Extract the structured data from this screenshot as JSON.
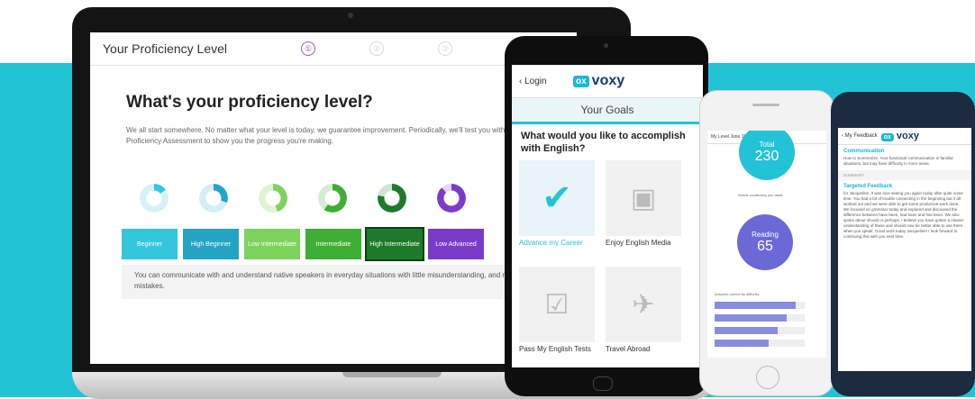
{
  "colors": {
    "background_band": "#23c3d6",
    "accent": "#1bb6d6",
    "purple": "#6b69d6"
  },
  "laptop": {
    "header_title": "Your Proficiency Level",
    "steps": [
      "①",
      "②",
      "③"
    ],
    "heading": "What's your proficiency level?",
    "intro": "We all start somewhere. No matter what your level is today, we guarantee improvement. Periodically, we'll test you with the Voxy Proficiency Assessment to show you the progress you're making.",
    "levels": [
      {
        "label": "Beginner",
        "color": "#33c6dc"
      },
      {
        "label": "High Beginner",
        "color": "#25a4c4"
      },
      {
        "label": "Low Intermediate",
        "color": "#7ed35c"
      },
      {
        "label": "Intermediate",
        "color": "#3fae34"
      },
      {
        "label": "High Intermediate",
        "color": "#1c7a2a"
      },
      {
        "label": "Low Advanced",
        "color": "#7b3bc9"
      }
    ],
    "selected_level": "High Intermediate",
    "description": "You can communicate with and understand native speakers in everyday situations with little misunderstanding, and make occasional mistakes."
  },
  "tablet": {
    "back": "Login",
    "logo": "voxy",
    "title": "Your Goals",
    "question": "What would you like to accomplish with English?",
    "goals": [
      {
        "label": "Advance my Career",
        "icon": "checkmark-icon",
        "selected": true
      },
      {
        "label": "Enjoy English Media",
        "icon": "media-icon",
        "selected": false
      },
      {
        "label": "Pass My English Tests",
        "icon": "checklist-icon",
        "selected": false
      },
      {
        "label": "Travel Abroad",
        "icon": "airplane-icon",
        "selected": false
      }
    ]
  },
  "phone_white": {
    "top_bar": "My Level  June 19, 2017 NPA",
    "top_score_label": "Total",
    "top_score": "230",
    "note": "Words vocabulary you used",
    "reading_label": "Reading",
    "reading_score": "65",
    "chart_label": "Answers correct by difficulty",
    "bars": [
      0.9,
      0.8,
      0.7,
      0.6
    ]
  },
  "phone_dark": {
    "back": "My Feedback",
    "logo": "voxy",
    "section1_heading": "Communication",
    "section1_text": "How to Summarize. Your functional communication in familiar situations, but may have difficulty in more areas.",
    "separator": "SUMMARY",
    "section2_heading": "Targeted Feedback",
    "section2_text": "for Jacqueline, It was nice seeing you again today after quite some time. You had a bit of trouble connecting in the beginning but it all worked out and we were able to get some productive work done. We focused on grammar today and explored and discussed the difference between have been, had been and has been. We also spoke about should or perhaps. I believe you have gotten a clearer understanding of these and should now be better able to use them when you speak. Good work today Jacqueline! I look forward to continuing this with you next time."
  }
}
